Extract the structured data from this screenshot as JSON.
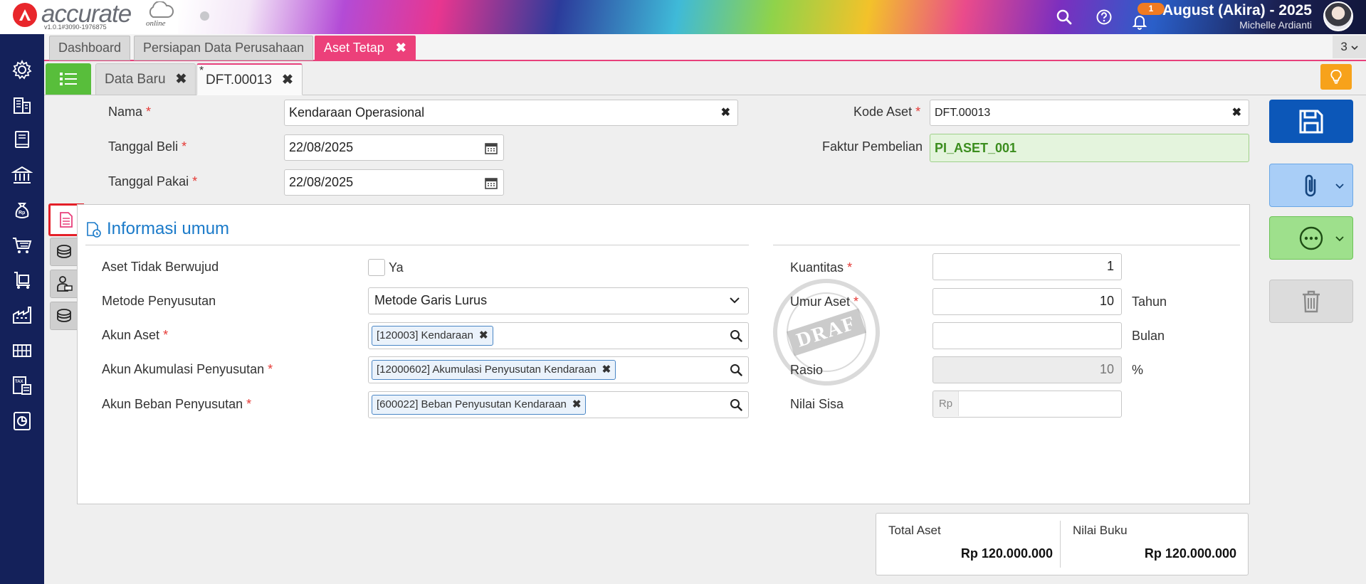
{
  "header": {
    "logo_text": "accurate",
    "logo_sub": "online",
    "version": "v1.0.1#3090-1976875",
    "notification_count": "1",
    "database_name": "August (Akira) - 2025",
    "user_name": "Michelle Ardianti"
  },
  "module_tabs": {
    "items": [
      {
        "label": "Dashboard"
      },
      {
        "label": "Persiapan Data Perusahaan"
      },
      {
        "label": "Aset Tetap"
      }
    ],
    "close_symbol": "✖",
    "open_count": "3"
  },
  "sub_tabs": {
    "items": [
      {
        "label": "Data Baru"
      },
      {
        "label": "DFT.00013"
      }
    ],
    "dirty_marker": "*",
    "close_symbol": "✖"
  },
  "form": {
    "nama_label": "Nama",
    "nama_value": "Kendaraan Operasional",
    "tanggal_beli_label": "Tanggal Beli",
    "tanggal_beli_value": "22/08/2025",
    "tanggal_pakai_label": "Tanggal Pakai",
    "tanggal_pakai_value": "22/08/2025",
    "kode_aset_label": "Kode Aset",
    "kode_aset_value": "DFT.00013",
    "faktur_label": "Faktur Pembelian",
    "faktur_value": "PI_ASET_001",
    "required_mark": "*",
    "clear_symbol": "✖"
  },
  "section": {
    "title": "Informasi umum",
    "aset_tidak_berwujud_label": "Aset Tidak Berwujud",
    "ya_label": "Ya",
    "metode_label": "Metode Penyusutan",
    "metode_value": "Metode Garis Lurus",
    "akun_aset_label": "Akun Aset",
    "akun_aset_tag": "[120003] Kendaraan",
    "akun_akumulasi_label": "Akun Akumulasi Penyusutan",
    "akun_akumulasi_tag": "[12000602] Akumulasi Penyusutan Kendaraan",
    "akun_beban_label": "Akun Beban Penyusutan",
    "akun_beban_tag": "[600022] Beban Penyusutan Kendaraan",
    "kuantitas_label": "Kuantitas",
    "kuantitas_value": "1",
    "umur_label": "Umur Aset",
    "umur_tahun_value": "10",
    "tahun_label": "Tahun",
    "umur_bulan_value": "",
    "bulan_label": "Bulan",
    "rasio_label": "Rasio",
    "rasio_value": "10",
    "percent_label": "%",
    "nilai_sisa_label": "Nilai Sisa",
    "currency_prefix": "Rp",
    "stamp_text": "DRAF"
  },
  "totals": {
    "total_aset_label": "Total Aset",
    "total_aset_value": "Rp 120.000.000",
    "nilai_buku_label": "Nilai Buku",
    "nilai_buku_value": "Rp 120.000.000"
  },
  "colors": {
    "sidebar": "#14215a",
    "accent_pink": "#ec407a",
    "save_button": "#0c57b8",
    "attach_button": "#a9cef7",
    "more_button": "#9ee08c",
    "delete_button": "#dcdcdc",
    "list_button": "#58be3b",
    "bulb_button": "#f7a21b",
    "section_title": "#1a7ac9"
  },
  "icons": {
    "sidebar": [
      "gear-icon",
      "building-icon",
      "book-icon",
      "bank-icon",
      "money-bag-icon",
      "cart-icon",
      "trolley-icon",
      "factory-icon",
      "inventory-icon",
      "tax-icon",
      "report-icon"
    ],
    "vertical_tabs": [
      "document-icon",
      "stack-icon",
      "user-money-icon",
      "stack-icon"
    ]
  }
}
